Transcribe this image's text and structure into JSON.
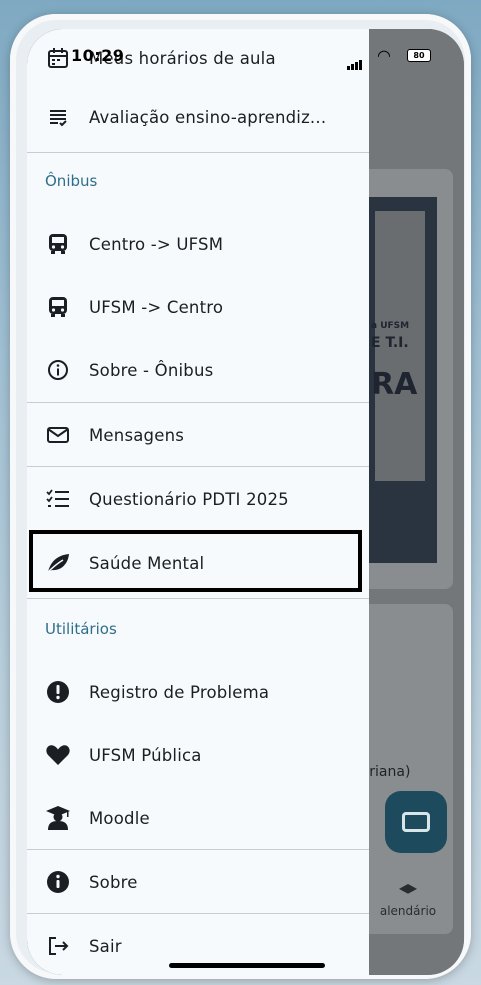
{
  "status_bar": {
    "time": "10:29",
    "battery": "80"
  },
  "drawer": {
    "items_top": [
      {
        "label": "Meus horários de aula",
        "icon": "calendar-icon"
      },
      {
        "label": "Avaliação ensino-aprendiz...",
        "icon": "checklist-icon"
      }
    ],
    "section_bus": "Ônibus",
    "bus_items": [
      {
        "label": "Centro -> UFSM",
        "icon": "bus-icon"
      },
      {
        "label": "UFSM -> Centro",
        "icon": "bus-icon"
      },
      {
        "label": "Sobre - Ônibus",
        "icon": "info-outline-icon"
      }
    ],
    "items_mid": [
      {
        "label": "Mensagens",
        "icon": "mail-icon"
      },
      {
        "label": "Questionário PDTI 2025",
        "icon": "list-check-icon"
      },
      {
        "label": "Saúde Mental",
        "icon": "leaf-icon"
      }
    ],
    "section_utils": "Utilitários",
    "util_items": [
      {
        "label": "Registro de Problema",
        "icon": "alert-circle-icon"
      },
      {
        "label": "UFSM Pública",
        "icon": "heart-icon"
      },
      {
        "label": "Moodle",
        "icon": "graduate-icon"
      }
    ],
    "items_bottom": [
      {
        "label": "Sobre",
        "icon": "info-filled-icon"
      },
      {
        "label": "Sair",
        "icon": "logout-icon"
      }
    ]
  },
  "background": {
    "poster_line1": "a UFSM",
    "poster_line2": "E T.I.",
    "poster_line3": "RA",
    "card_caption": "cariana)",
    "calendar_label": "alendário"
  },
  "colors": {
    "section_text": "#2e6e8a",
    "fab": "#1e4a5e"
  }
}
